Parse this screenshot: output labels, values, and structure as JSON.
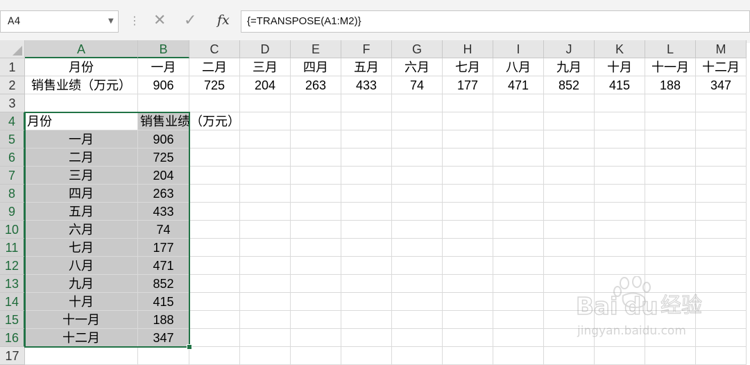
{
  "formula_bar": {
    "name_box": "A4",
    "formula": "{=TRANSPOSE(A1:M2)}",
    "fx_label": "fx"
  },
  "columns": [
    "A",
    "B",
    "C",
    "D",
    "E",
    "F",
    "G",
    "H",
    "I",
    "J",
    "K",
    "L",
    "M"
  ],
  "rows": [
    "1",
    "2",
    "3",
    "4",
    "5",
    "6",
    "7",
    "8",
    "9",
    "10",
    "11",
    "12",
    "13",
    "14",
    "15",
    "16",
    "17"
  ],
  "row1": [
    "月份",
    "一月",
    "二月",
    "三月",
    "四月",
    "五月",
    "六月",
    "七月",
    "八月",
    "九月",
    "十月",
    "十一月",
    "十二月"
  ],
  "row2": [
    "销售业绩（万元）",
    "906",
    "725",
    "204",
    "263",
    "433",
    "74",
    "177",
    "471",
    "852",
    "415",
    "188",
    "347"
  ],
  "transposed_header": [
    "月份",
    "销售业绩（万元）"
  ],
  "transposed_rows": [
    [
      "一月",
      "906"
    ],
    [
      "二月",
      "725"
    ],
    [
      "三月",
      "204"
    ],
    [
      "四月",
      "263"
    ],
    [
      "五月",
      "433"
    ],
    [
      "六月",
      "74"
    ],
    [
      "七月",
      "177"
    ],
    [
      "八月",
      "471"
    ],
    [
      "九月",
      "852"
    ],
    [
      "十月",
      "415"
    ],
    [
      "十一月",
      "188"
    ],
    [
      "十二月",
      "347"
    ]
  ],
  "selected_range": "A4:B16",
  "watermark": {
    "brand": "Baidu",
    "cn": "经验",
    "url": "jingyan.baidu.com"
  },
  "colors": {
    "accent": "#217346",
    "selection_fill": "#c9c9c9"
  }
}
